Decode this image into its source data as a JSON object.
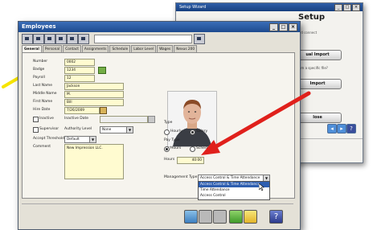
{
  "wizard": {
    "title": "Setup Wizard",
    "heading": "Setup",
    "connect_text": "...rd connect",
    "buttons": [
      "ual Import",
      "Import",
      "lose"
    ],
    "question_text": "from a specific file?"
  },
  "employees": {
    "title": "Employees",
    "tabs": [
      "General",
      "Personal",
      "Contact",
      "Assignments",
      "Schedule",
      "Labor Level",
      "Wages",
      "Nexus 200"
    ],
    "fields": {
      "number": {
        "label": "Number",
        "value": "0002"
      },
      "badge": {
        "label": "Badge",
        "value": "1234"
      },
      "payroll": {
        "label": "Payroll",
        "value": "12"
      },
      "last_name": {
        "label": "Last Name",
        "value": "Jackson"
      },
      "middle_name": {
        "label": "Middle Name",
        "value": "M."
      },
      "first_name": {
        "label": "First Name",
        "value": "Bill"
      },
      "hire_date": {
        "label": "Hire Date",
        "value": "7/26/2009"
      },
      "inactive": {
        "label": "Inactive",
        "checked": false
      },
      "inactive_date": {
        "label": "Inactive Date"
      },
      "supervisor": {
        "label": "Supervisor",
        "checked": false
      },
      "authority_level": {
        "label": "Authority Level",
        "value": "None"
      },
      "accept_threshold": {
        "label": "Accept Threshold",
        "value": "Default"
      },
      "comment": {
        "label": "Comment",
        "value": "New Impression LLC."
      }
    },
    "type": {
      "label": "Type",
      "options": [
        "Hourly",
        "Salary"
      ],
      "selected": "Salary"
    },
    "pay_type": {
      "label": "Pay Type",
      "options": [
        "Hours",
        "Schedule"
      ],
      "selected": "Hours"
    },
    "hours": {
      "label": "Hours",
      "value": "40:00"
    },
    "management_type": {
      "label": "Management Type",
      "value": "Access Control & Time Attendance",
      "options": [
        "Access Control & Time Attendance",
        "Time Attendance",
        "Access Control"
      ],
      "highlighted": "Access Control & Time Attendance"
    }
  },
  "colors": {
    "title_bar": "#1d4a8e",
    "field_yellow": "#fffbd0",
    "arrow_red": "#e0201b",
    "arrow_yellow": "#f7e500",
    "dropdown_highlight": "#2f5fb0"
  },
  "icons": [
    "arrow-pointer",
    "calendar-icon",
    "group-icon",
    "help-icon",
    "save-icon",
    "print-icon",
    "ok-icon",
    "close-icon"
  ]
}
